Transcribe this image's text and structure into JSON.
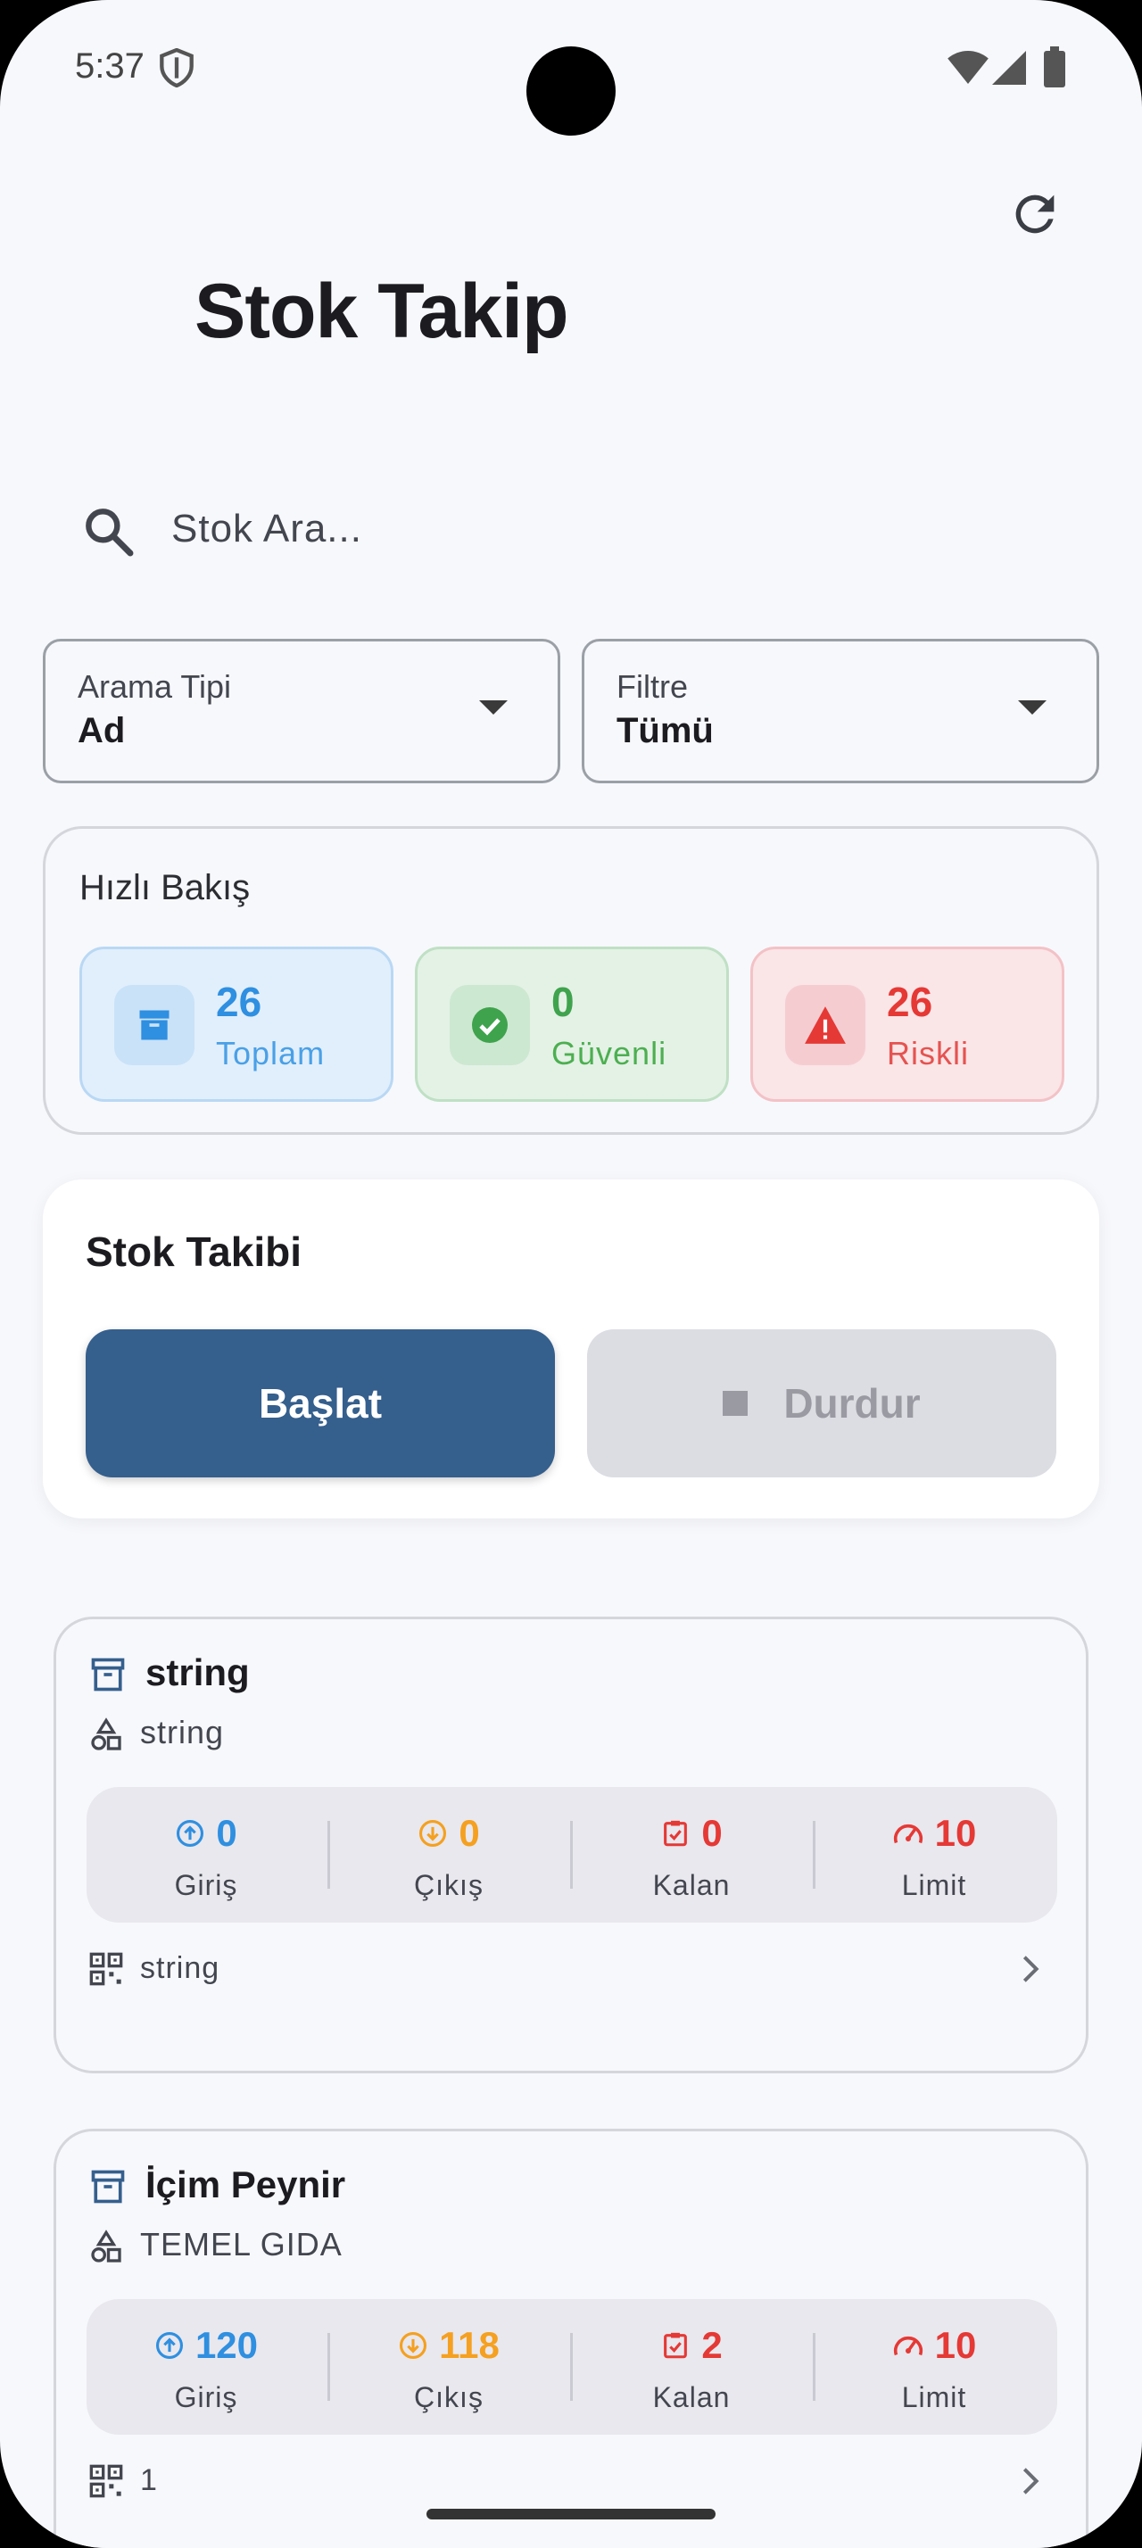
{
  "status_bar": {
    "time": "5:37"
  },
  "header": {
    "title": "Stok Takip"
  },
  "search": {
    "placeholder": "Stok Ara..."
  },
  "filters": {
    "search_type": {
      "label": "Arama Tipi",
      "value": "Ad"
    },
    "filter": {
      "label": "Filtre",
      "value": "Tümü"
    }
  },
  "overview": {
    "title": "Hızlı Bakış",
    "stats": [
      {
        "value": "26",
        "label": "Toplam"
      },
      {
        "value": "0",
        "label": "Güvenli"
      },
      {
        "value": "26",
        "label": "Riskli"
      }
    ]
  },
  "tracking": {
    "title": "Stok Takibi",
    "start_label": "Başlat",
    "stop_label": "Durdur"
  },
  "metric_labels": {
    "in": "Giriş",
    "out": "Çıkış",
    "remaining": "Kalan",
    "limit": "Limit"
  },
  "items": [
    {
      "name": "string",
      "category": "string",
      "in": "0",
      "out": "0",
      "remaining": "0",
      "limit": "10",
      "code": "string"
    },
    {
      "name": "İçim Peynir",
      "category": "TEMEL GIDA",
      "in": "120",
      "out": "118",
      "remaining": "2",
      "limit": "10",
      "code": "1"
    }
  ],
  "colors": {
    "primary": "#355f8d",
    "blue": "#2f8fe0",
    "green": "#3fa34d",
    "red": "#e53935",
    "orange": "#f5a020",
    "disabled": "#dcdde2"
  }
}
